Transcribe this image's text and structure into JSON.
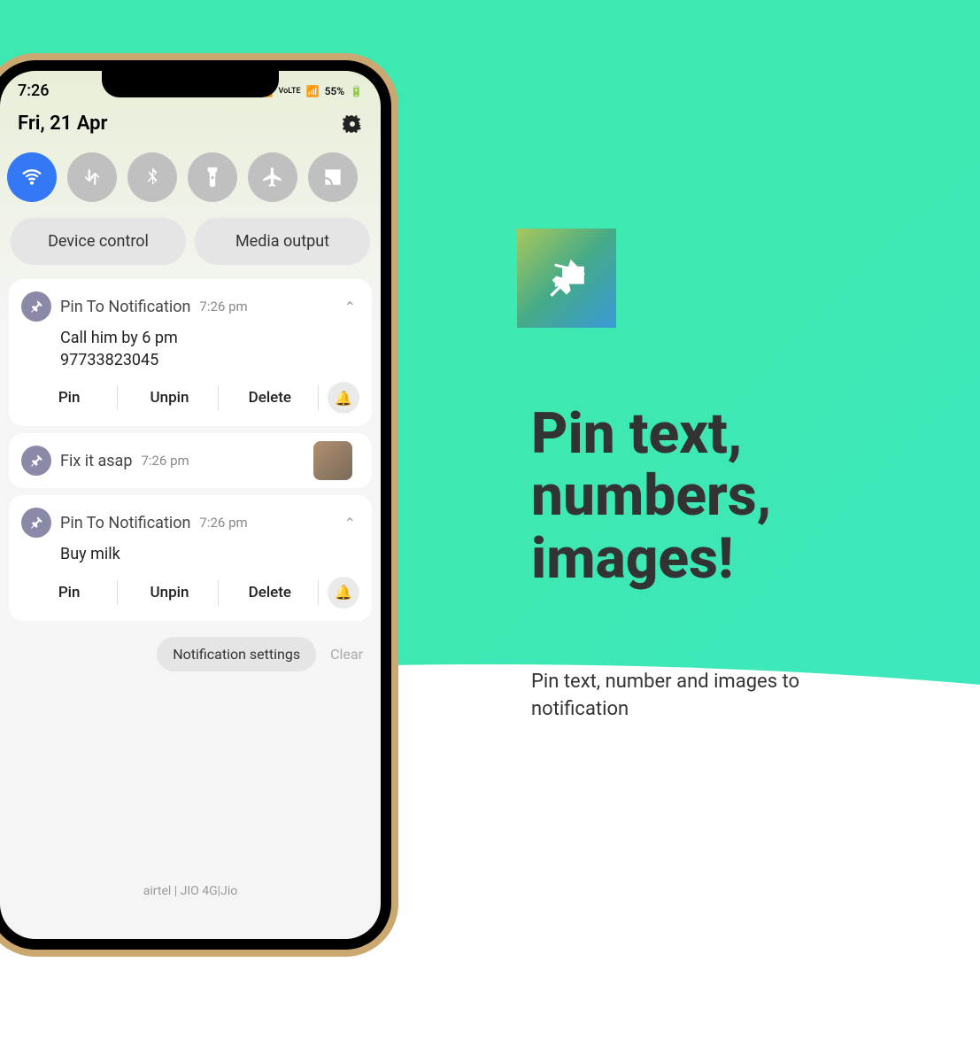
{
  "status": {
    "time": "7:26",
    "battery": "55%"
  },
  "date": "Fri, 21 Apr",
  "pills": {
    "device": "Device control",
    "media": "Media output"
  },
  "notifications": [
    {
      "app": "Pin To Notification",
      "time": "7:26 pm",
      "lines": [
        "Call him by 6 pm",
        "97733823045"
      ],
      "actions": [
        "Pin",
        "Unpin",
        "Delete"
      ],
      "bell": true
    },
    {
      "app": "Fix it asap",
      "time": "7:26 pm",
      "thumbnail": true
    },
    {
      "app": "Pin To Notification",
      "time": "7:26 pm",
      "lines": [
        "Buy milk"
      ],
      "actions": [
        "Pin",
        "Unpin",
        "Delete"
      ],
      "bell": true
    }
  ],
  "footer": {
    "settings": "Notification settings",
    "clear": "Clear"
  },
  "carrier": "airtel | JIO 4G|Jio",
  "headline": "Pin text,\nnumbers,\nimages!",
  "subhead": "Pin text, number and images to notification"
}
